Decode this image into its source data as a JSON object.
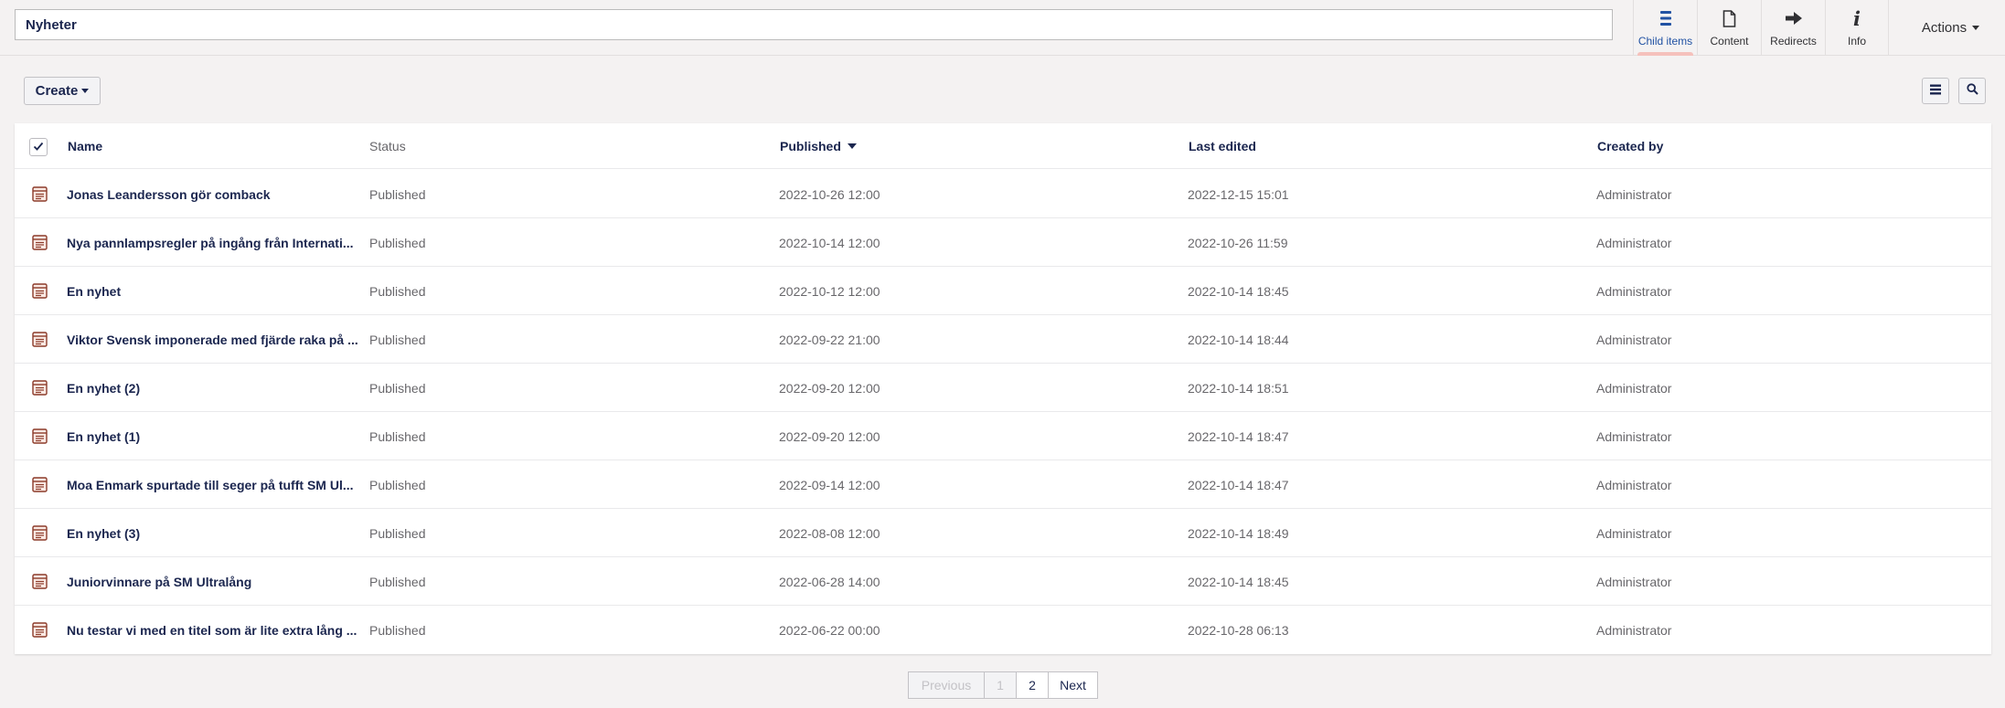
{
  "header": {
    "name_value": "Nyheter",
    "apps": [
      {
        "label": "Child items",
        "icon": "list-icon",
        "active": true
      },
      {
        "label": "Content",
        "icon": "document-icon",
        "active": false
      },
      {
        "label": "Redirects",
        "icon": "arrow-right-icon",
        "active": false
      },
      {
        "label": "Info",
        "icon": "info-icon",
        "active": false
      }
    ],
    "actions_label": "Actions"
  },
  "toolbar": {
    "create_label": "Create",
    "list_view_icon": "list-view-icon",
    "search_icon": "search-icon"
  },
  "table": {
    "columns": {
      "name": "Name",
      "status": "Status",
      "published": "Published",
      "last_edited": "Last edited",
      "created_by": "Created by"
    },
    "sort_column": "published",
    "sort_direction": "desc",
    "rows": [
      {
        "name": "Jonas Leandersson gör comback",
        "status": "Published",
        "published": "2022-10-26 12:00",
        "last_edited": "2022-12-15 15:01",
        "created_by": "Administrator"
      },
      {
        "name": "Nya pannlampsregler på ingång från Internati...",
        "status": "Published",
        "published": "2022-10-14 12:00",
        "last_edited": "2022-10-26 11:59",
        "created_by": "Administrator"
      },
      {
        "name": "En nyhet",
        "status": "Published",
        "published": "2022-10-12 12:00",
        "last_edited": "2022-10-14 18:45",
        "created_by": "Administrator"
      },
      {
        "name": "Viktor Svensk imponerade med fjärde raka på ...",
        "status": "Published",
        "published": "2022-09-22 21:00",
        "last_edited": "2022-10-14 18:44",
        "created_by": "Administrator"
      },
      {
        "name": "En nyhet (2)",
        "status": "Published",
        "published": "2022-09-20 12:00",
        "last_edited": "2022-10-14 18:51",
        "created_by": "Administrator"
      },
      {
        "name": "En nyhet (1)",
        "status": "Published",
        "published": "2022-09-20 12:00",
        "last_edited": "2022-10-14 18:47",
        "created_by": "Administrator"
      },
      {
        "name": "Moa Enmark spurtade till seger på tufft SM Ul...",
        "status": "Published",
        "published": "2022-09-14 12:00",
        "last_edited": "2022-10-14 18:47",
        "created_by": "Administrator"
      },
      {
        "name": "En nyhet (3)",
        "status": "Published",
        "published": "2022-08-08 12:00",
        "last_edited": "2022-10-14 18:49",
        "created_by": "Administrator"
      },
      {
        "name": "Juniorvinnare på SM Ultralång",
        "status": "Published",
        "published": "2022-06-28 14:00",
        "last_edited": "2022-10-14 18:45",
        "created_by": "Administrator"
      },
      {
        "name": "Nu testar vi med en titel som är lite extra lång ...",
        "status": "Published",
        "published": "2022-06-22 00:00",
        "last_edited": "2022-10-28 06:13",
        "created_by": "Administrator"
      }
    ]
  },
  "pagination": {
    "previous_label": "Previous",
    "pages": [
      "1",
      "2"
    ],
    "current_page": "1",
    "next_label": "Next"
  },
  "colors": {
    "primary_text": "#1b264f",
    "muted_text": "#68676b",
    "active_tab_underline": "#f5c1bc",
    "row_icon": "#8c3b2a"
  }
}
